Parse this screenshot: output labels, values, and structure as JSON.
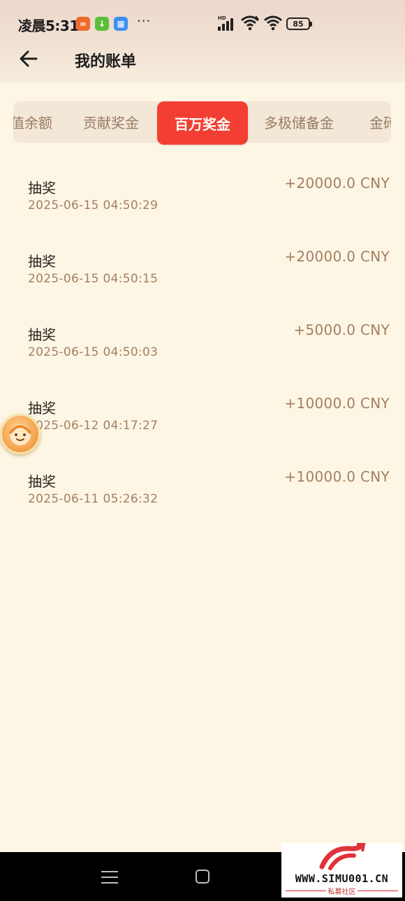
{
  "status_bar": {
    "time": "凌晨5:31",
    "dots": "···",
    "hd": "HD",
    "battery": "85"
  },
  "header": {
    "title": "我的账单"
  },
  "tabs": [
    {
      "label": "值余额"
    },
    {
      "label": "贡献奖金"
    },
    {
      "label": "百万奖金"
    },
    {
      "label": "多极储备金"
    },
    {
      "label": "金砖"
    }
  ],
  "active_tab": "百万奖金",
  "records": [
    {
      "type": "抽奖",
      "time": "2025-06-15 04:50:29",
      "amount": "+20000.0 CNY"
    },
    {
      "type": "抽奖",
      "time": "2025-06-15 04:50:15",
      "amount": "+20000.0 CNY"
    },
    {
      "type": "抽奖",
      "time": "2025-06-15 04:50:03",
      "amount": "+5000.0 CNY"
    },
    {
      "type": "抽奖",
      "time": "2025-06-12 04:17:27",
      "amount": "+10000.0 CNY"
    },
    {
      "type": "抽奖",
      "time": "2025-06-11 05:26:32",
      "amount": "+10000.0 CNY"
    }
  ],
  "watermark": {
    "text": "WWW.SIMU001.CN",
    "subtext": "私募社区"
  },
  "colors": {
    "accent": "#f33f33",
    "amount": "#a37f62",
    "background": "#fdf6e4"
  }
}
